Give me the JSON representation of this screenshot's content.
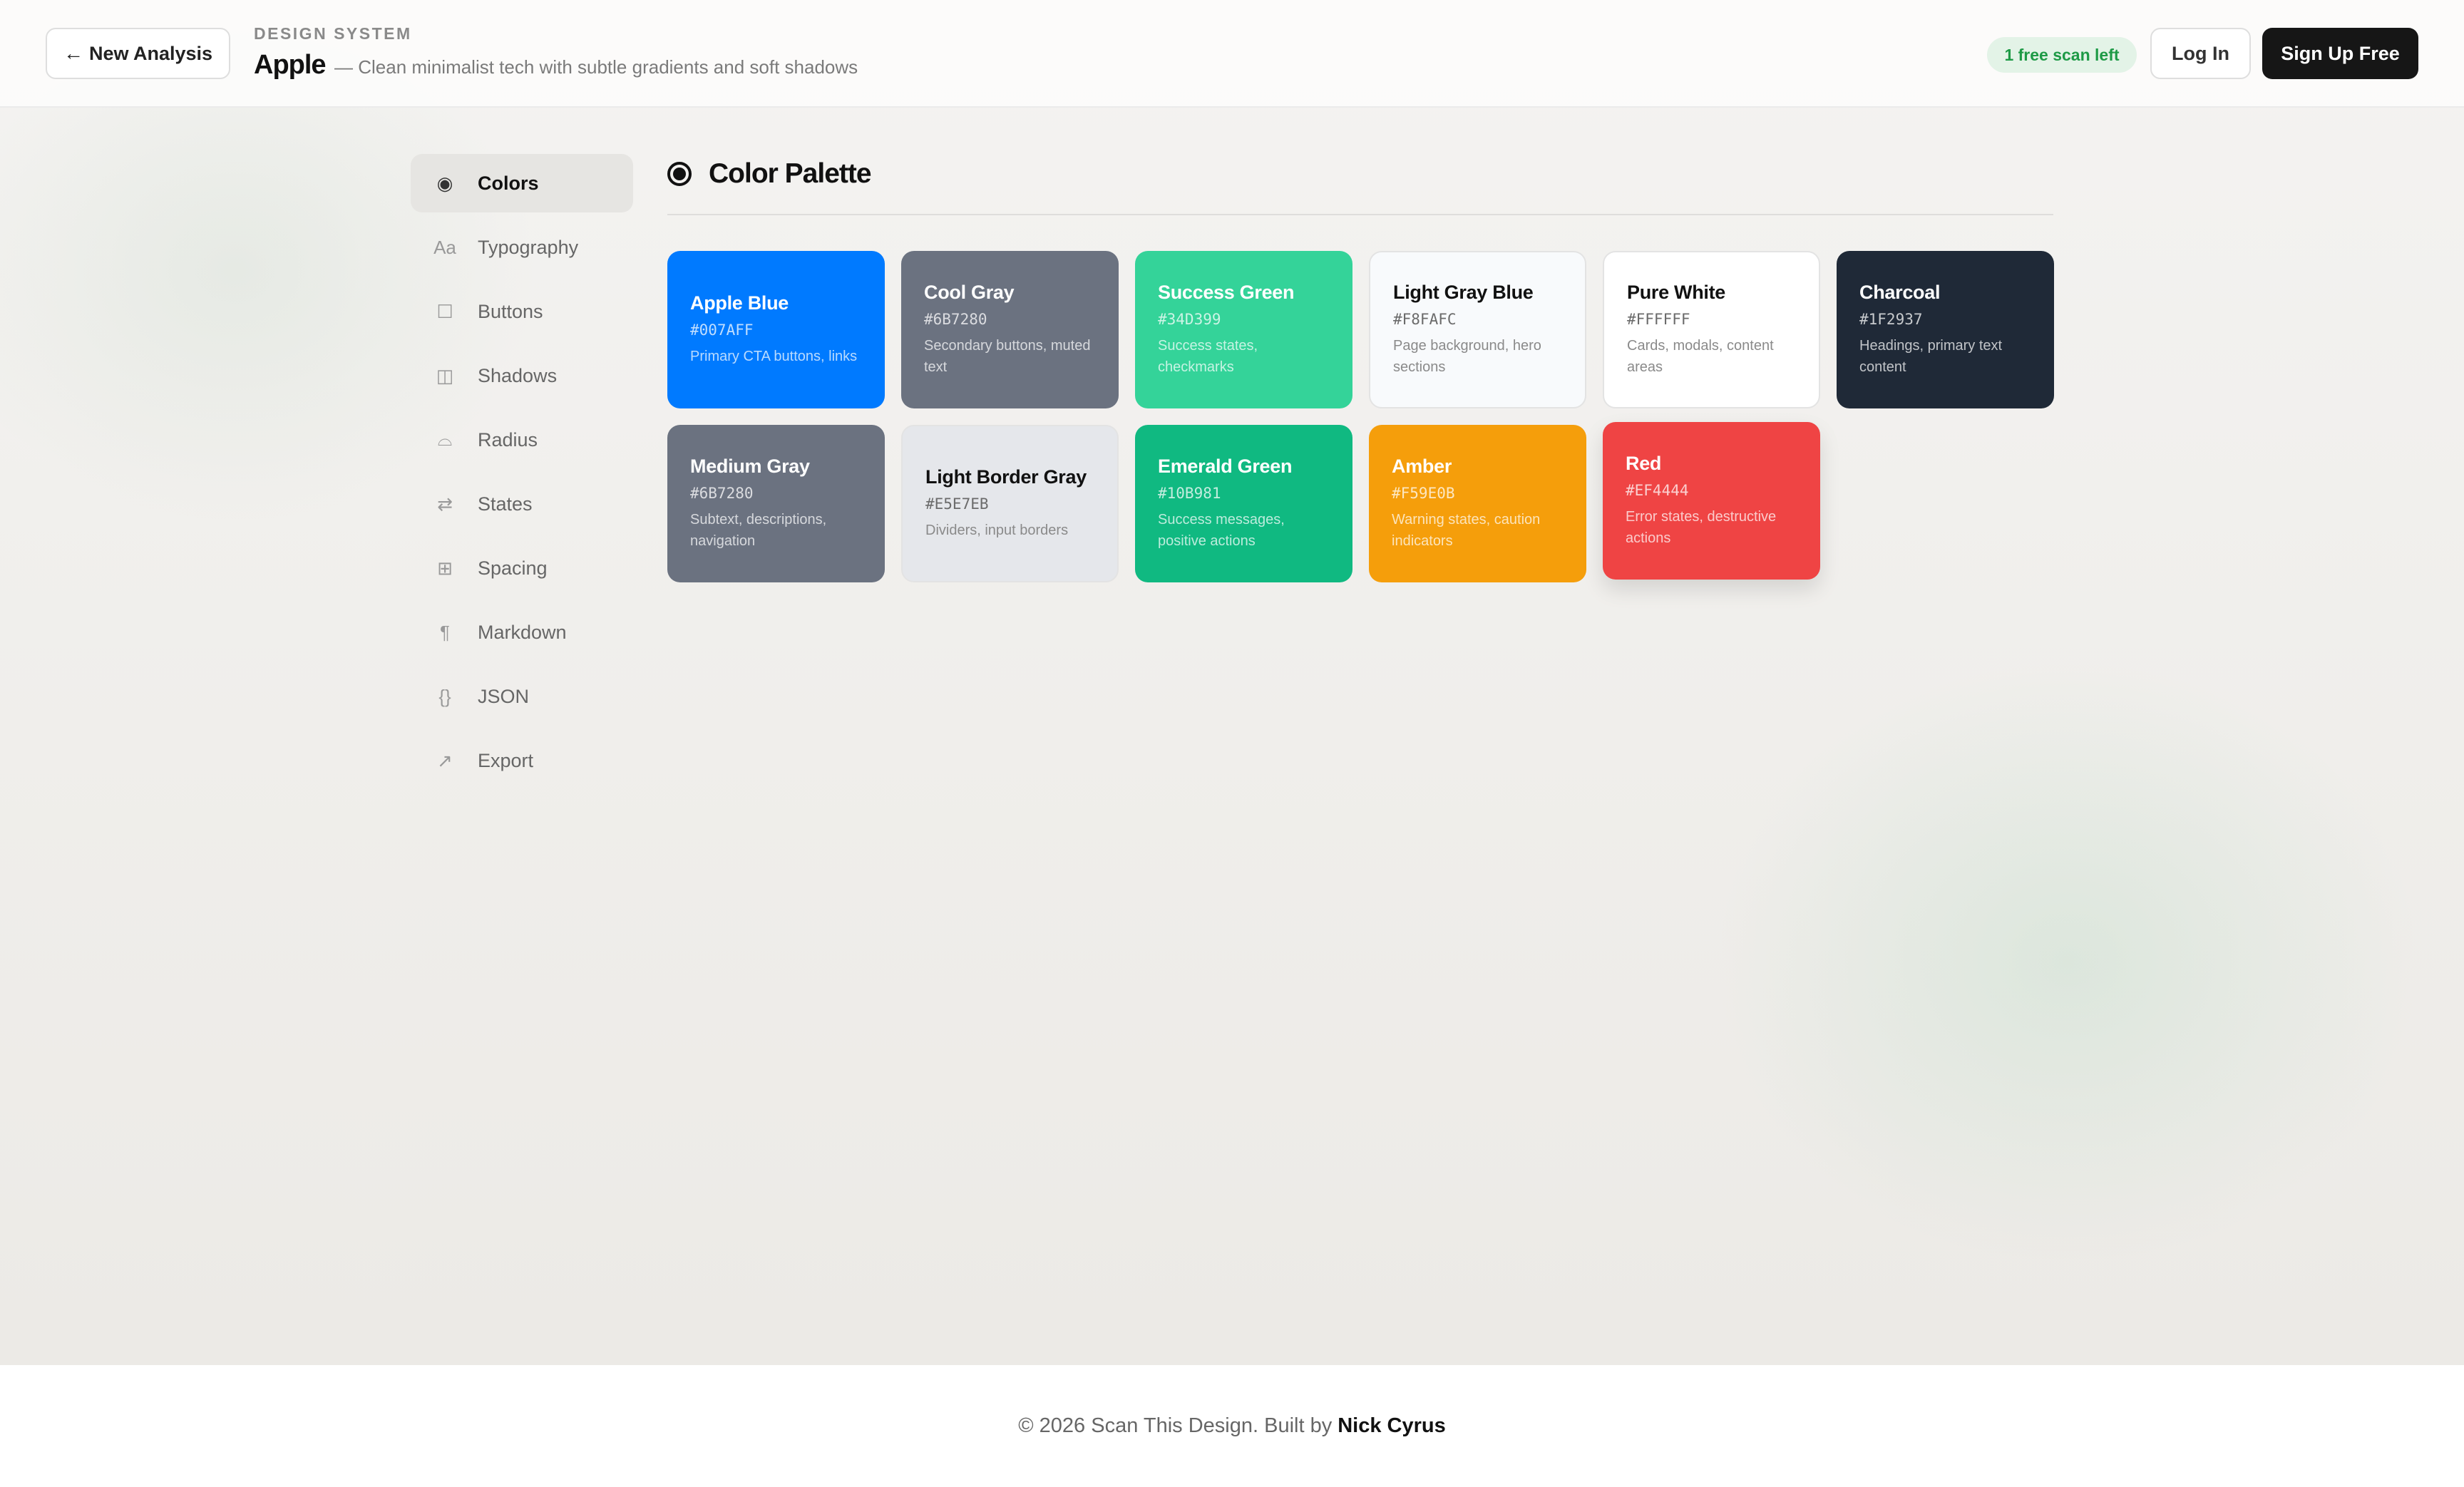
{
  "header": {
    "back_label": "New Analysis",
    "eyebrow": "DESIGN SYSTEM",
    "brand": "Apple",
    "tagline": "— Clean minimalist tech with subtle gradients and soft shadows",
    "scan_badge": "1 free scan left",
    "login_label": "Log In",
    "signup_label": "Sign Up Free"
  },
  "sidebar": {
    "items": [
      {
        "label": "Colors",
        "icon": "radio-dot-icon",
        "glyph": "◉",
        "active": true
      },
      {
        "label": "Typography",
        "icon": "typography-icon",
        "glyph": "Aa",
        "active": false
      },
      {
        "label": "Buttons",
        "icon": "square-icon",
        "glyph": "☐",
        "active": false
      },
      {
        "label": "Shadows",
        "icon": "layers-icon",
        "glyph": "◫",
        "active": false
      },
      {
        "label": "Radius",
        "icon": "radius-icon",
        "glyph": "⌓",
        "active": false
      },
      {
        "label": "States",
        "icon": "swap-icon",
        "glyph": "⇄",
        "active": false
      },
      {
        "label": "Spacing",
        "icon": "grid-icon",
        "glyph": "⊞",
        "active": false
      },
      {
        "label": "Markdown",
        "icon": "pilcrow-icon",
        "glyph": "¶",
        "active": false
      },
      {
        "label": "JSON",
        "icon": "braces-icon",
        "glyph": "{}",
        "active": false
      },
      {
        "label": "Export",
        "icon": "export-arrow-icon",
        "glyph": "↗",
        "active": false
      }
    ]
  },
  "main": {
    "section_title": "Color Palette",
    "swatches": [
      {
        "name": "Apple Blue",
        "hex": "#007AFF",
        "desc": "Primary CTA buttons, links",
        "bg": "#007AFF",
        "text": "light"
      },
      {
        "name": "Cool Gray",
        "hex": "#6B7280",
        "desc": "Secondary buttons, muted text",
        "bg": "#6B7280",
        "text": "light"
      },
      {
        "name": "Success Green",
        "hex": "#34D399",
        "desc": "Success states, checkmarks",
        "bg": "#34D399",
        "text": "light"
      },
      {
        "name": "Light Gray Blue",
        "hex": "#F8FAFC",
        "desc": "Page background, hero sections",
        "bg": "#F8FAFC",
        "text": "dark"
      },
      {
        "name": "Pure White",
        "hex": "#FFFFFF",
        "desc": "Cards, modals, content areas",
        "bg": "#FFFFFF",
        "text": "dark"
      },
      {
        "name": "Charcoal",
        "hex": "#1F2937",
        "desc": "Headings, primary text content",
        "bg": "#1F2937",
        "text": "light"
      },
      {
        "name": "Medium Gray",
        "hex": "#6B7280",
        "desc": "Subtext, descriptions, navigation",
        "bg": "#6B7280",
        "text": "light"
      },
      {
        "name": "Light Border Gray",
        "hex": "#E5E7EB",
        "desc": "Dividers, input borders",
        "bg": "#E5E7EB",
        "text": "dark"
      },
      {
        "name": "Emerald Green",
        "hex": "#10B981",
        "desc": "Success messages, positive actions",
        "bg": "#10B981",
        "text": "light"
      },
      {
        "name": "Amber",
        "hex": "#F59E0B",
        "desc": "Warning states, caution indicators",
        "bg": "#F59E0B",
        "text": "light"
      },
      {
        "name": "Red",
        "hex": "#EF4444",
        "desc": "Error states, destructive actions",
        "bg": "#EF4444",
        "text": "light"
      }
    ]
  },
  "footer": {
    "text": "© 2026 Scan This Design. Built by",
    "author": "Nick Cyrus"
  }
}
